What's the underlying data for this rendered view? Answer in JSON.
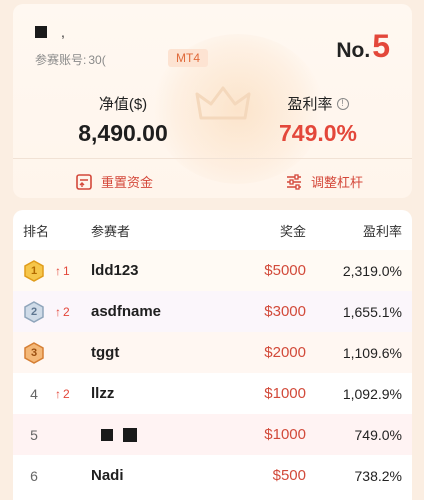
{
  "account": {
    "label": "参赛账号:",
    "value": "30(",
    "platform": "MT4",
    "rank_prefix": "No.",
    "rank": "5"
  },
  "stats": {
    "equity_label": "净值($)",
    "equity_value": "8,490.00",
    "profit_label": "盈利率",
    "profit_value": "749.0%"
  },
  "actions": {
    "reset": "重置资金",
    "leverage": "调整杠杆"
  },
  "table": {
    "headers": [
      "排名",
      "参赛者",
      "奖金",
      "盈利率"
    ],
    "rows": [
      {
        "rank": "1",
        "change": "1",
        "name": "ldd123",
        "prize": "$5000",
        "rate": "2,319.0%"
      },
      {
        "rank": "2",
        "change": "2",
        "name": "asdfname",
        "prize": "$3000",
        "rate": "1,655.1%"
      },
      {
        "rank": "3",
        "change": "",
        "name": "tggt",
        "prize": "$2000",
        "rate": "1,109.6%"
      },
      {
        "rank": "4",
        "change": "2",
        "name": "llzz",
        "prize": "$1000",
        "rate": "1,092.9%"
      },
      {
        "rank": "5",
        "change": "",
        "name": "",
        "prize": "$1000",
        "rate": "749.0%"
      },
      {
        "rank": "6",
        "change": "",
        "name": "Nadi",
        "prize": "$500",
        "rate": "738.2%"
      }
    ]
  },
  "colors": {
    "accent": "#e3473a",
    "gold": "#f2b233",
    "silver": "#9fb3c6",
    "bronze": "#e8974c",
    "row_highlight": "#fff3f3"
  }
}
